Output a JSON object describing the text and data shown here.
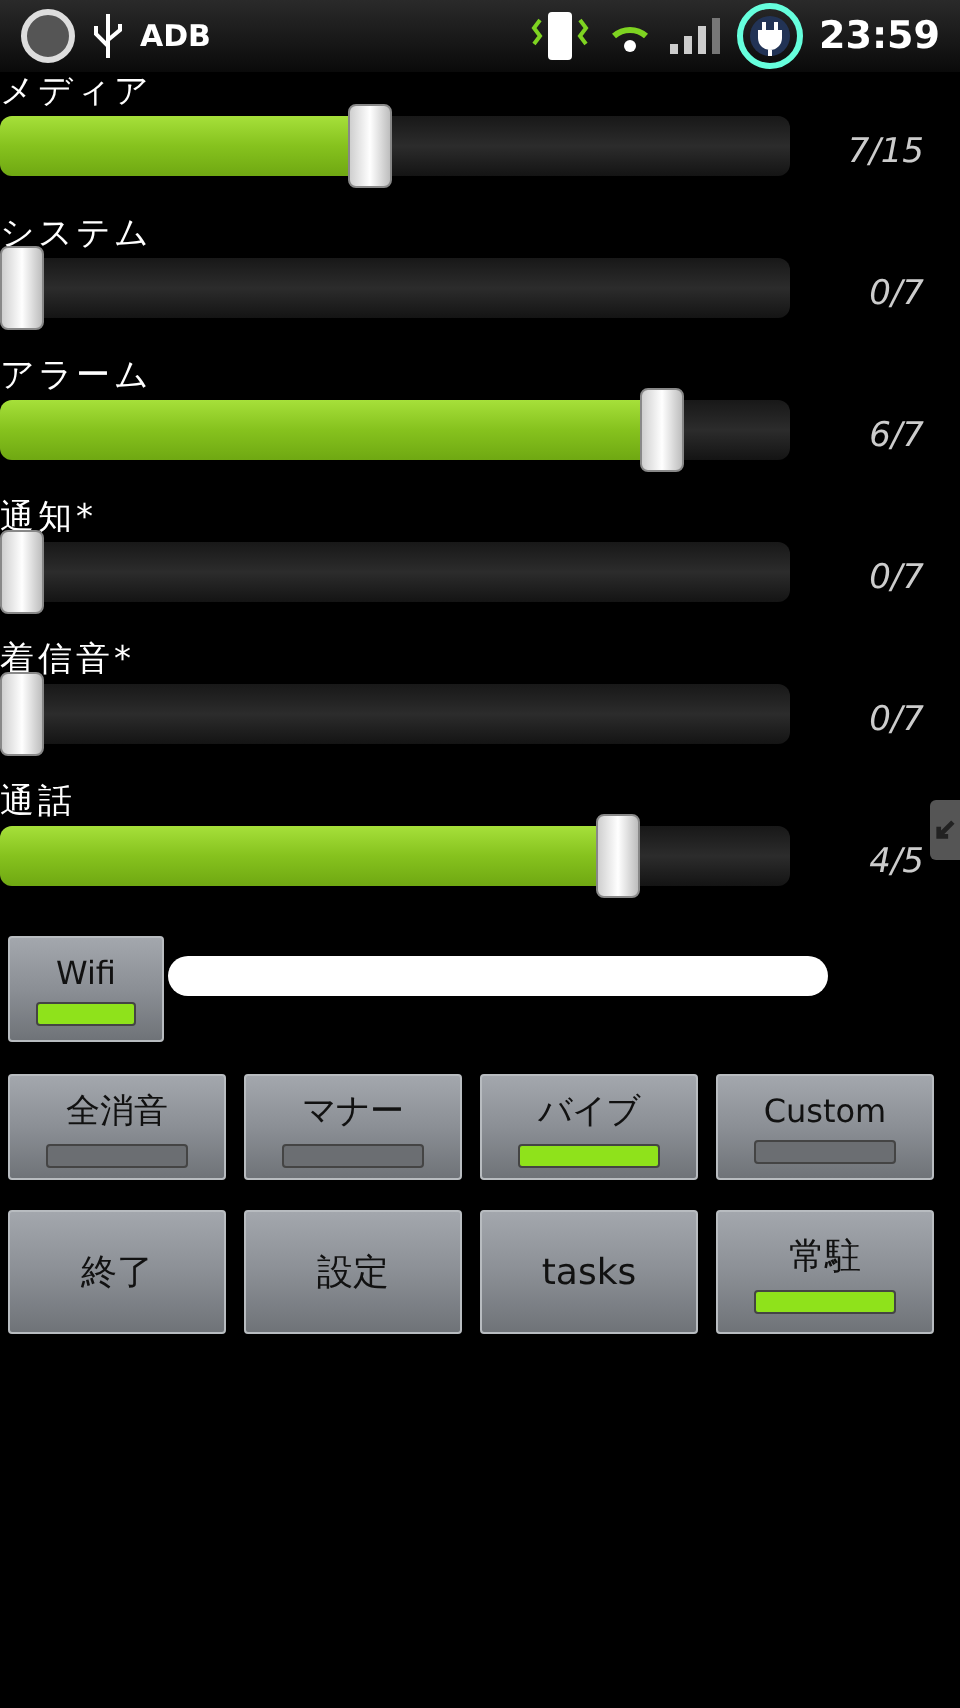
{
  "status_bar": {
    "notification": "ADB",
    "time": "23:59"
  },
  "sliders": [
    {
      "label": "メディア",
      "level": 0.467,
      "reading": "7/15"
    },
    {
      "label": "システム",
      "level": 0,
      "reading": "0/7"
    },
    {
      "label": "アラーム",
      "level": 0.857,
      "reading": "6/7"
    },
    {
      "label": "通知*",
      "level": 0,
      "reading": "0/7"
    },
    {
      "label": "着信音*",
      "level": 0,
      "reading": "0/7"
    },
    {
      "label": "通話",
      "level": 0.8,
      "reading": "4/5"
    }
  ],
  "wifi_button": {
    "label": "Wifi",
    "on": true
  },
  "mode_buttons": [
    {
      "label": "全消音",
      "on": false
    },
    {
      "label": "マナー",
      "on": false
    },
    {
      "label": "バイブ",
      "on": true
    },
    {
      "label": "Custom",
      "on": false
    }
  ],
  "action_buttons": [
    {
      "label": "終了",
      "kind": "plain"
    },
    {
      "label": "設定",
      "kind": "plain"
    },
    {
      "label": "tasks",
      "kind": "plain"
    },
    {
      "label": "常駐",
      "kind": "toggle",
      "on": true
    }
  ]
}
